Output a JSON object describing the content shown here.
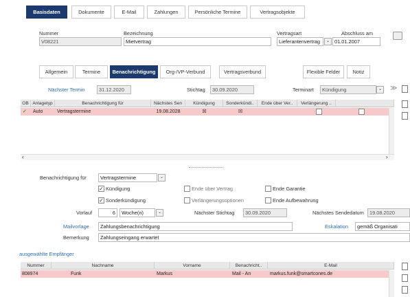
{
  "top_tabs": [
    "Basisdaten",
    "Dokumente",
    "E-Mail",
    "Zahlungen",
    "Persönliche Termine",
    "Vertragsobjekte"
  ],
  "header": {
    "nummer_label": "Nummer",
    "nummer_value": "V08221",
    "bezeichnung_label": "Bezeichnung",
    "bezeichnung_value": "Mietvertrag",
    "vertragsart_label": "Vertragsart",
    "vertragsart_value": "Lieferantenvertrag",
    "abschluss_label": "Abschluss am",
    "abschluss_value": "01.01.2007"
  },
  "sub_tabs": [
    "Allgemein",
    "Termine",
    "Benachrichtigung",
    "Org-/VP-Verbund",
    "Vertragsverbund",
    "Flexible Felder",
    "Notiz"
  ],
  "termin": {
    "naechster_label": "Nächster Termin",
    "naechster_value": "31.12.2020",
    "stichtag_label": "Stichtag",
    "stichtag_value": "30.09.2020",
    "terminart_label": "Terminart",
    "terminart_value": "Kündigung"
  },
  "grid1": {
    "headers": [
      "OB",
      "Anlagetyp",
      "Benachrichtigung für",
      "Nächstes Sen",
      "Kündigung",
      "Sonderkündi..",
      "Ende über Ver..",
      "Verlängerung .."
    ],
    "rows": [
      {
        "ob": "✓",
        "anlagetyp": "Auto",
        "fuer": "Vertragstermine",
        "naechstes": "19.08.2028",
        "kuendigung": "☒",
        "sonder": "☒",
        "ende": "",
        "verl": ""
      }
    ]
  },
  "form": {
    "benachrichtigung_label": "Benachrichtigung für",
    "benachrichtigung_value": "Vertragstermine",
    "kuendigung": "Kündigung",
    "sonderkuendigung": "Sonderkündigung",
    "ende_vertrag": "Ende über Vertrag",
    "verlaengerungsoptionen": "Verlängerungsoptionen",
    "ende_garantie": "Ende Garantie",
    "ende_aufbewahrung": "Ende Aufbewahrung",
    "vorlauf_label": "Vorlauf",
    "vorlauf_num": "6",
    "vorlauf_unit": "Woche(n)",
    "naechster_stichtag_label": "Nächster Stichtag",
    "naechster_stichtag_value": "30.09.2020",
    "naechstes_sendedatum_label": "Nächstes Sendedatum",
    "naechstes_sendedatum_value": "19.08.2020",
    "mailvorlage_label": "Mailvorlage",
    "mailvorlage_value": "Zahlungsbenachrichtigung",
    "eskalation_label": "Eskalation",
    "eskalation_value": "gemäß Organisati",
    "bemerkung_label": "Bemerkung",
    "bemerkung_value": "Zahlungseingang erwartet"
  },
  "empfaenger_title": "ausgewählte Empfänger",
  "grid2": {
    "headers": [
      "Nummer",
      "Nachname",
      "Vorname",
      "Benachricht..",
      "E-Mail"
    ],
    "rows": [
      {
        "nummer": "808974",
        "nachname": "Funk",
        "vorname": "Markus",
        "benachricht": "Mail - An",
        "email": "markus.funk@smartcones.de"
      }
    ]
  }
}
